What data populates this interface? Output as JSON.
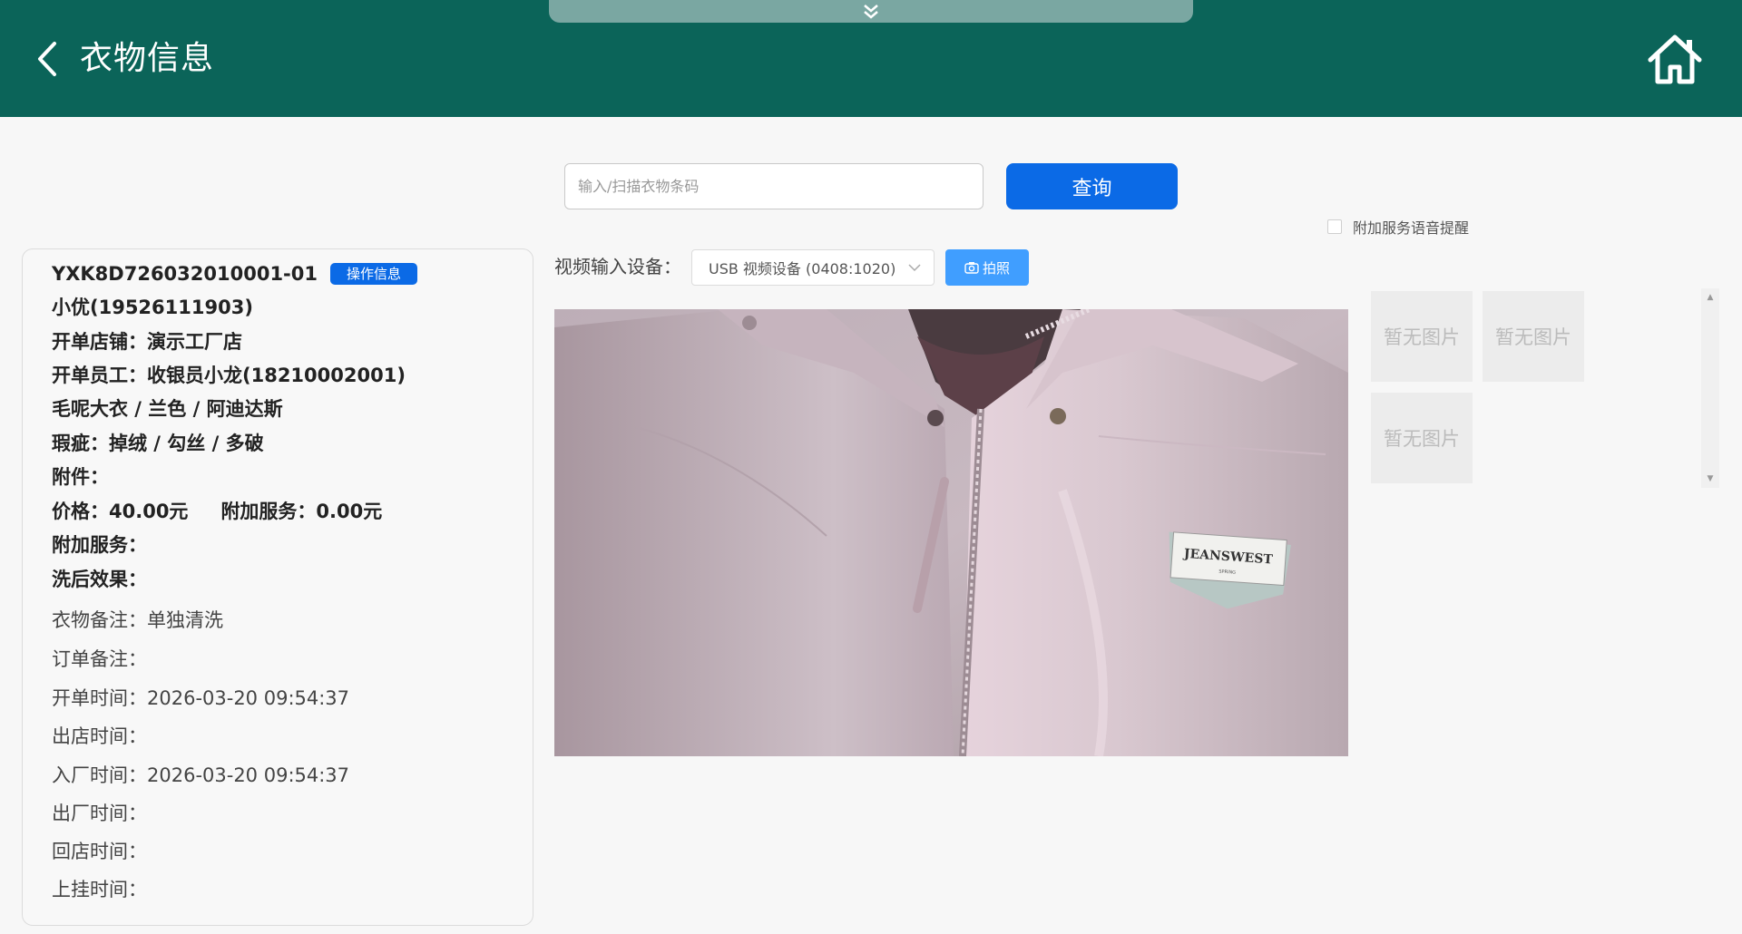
{
  "header": {
    "title": "衣物信息",
    "pull_tab_icon": "double-chevron-down-icon",
    "back_icon": "chevron-left-icon",
    "home_icon": "home-icon"
  },
  "search": {
    "placeholder": "输入/扫描衣物条码",
    "value": "",
    "query_label": "查询"
  },
  "voice_reminder": {
    "label": "附加服务语音提醒",
    "checked": false
  },
  "garment": {
    "code": "YXK8D726032010001-01",
    "op_badge": "操作信息",
    "customer": "小优(19526111903)",
    "store": "开单店铺：演示工厂店",
    "staff": "开单员工：收银员小龙(18210002001)",
    "desc": "毛呢大衣 / 兰色 / 阿迪达斯",
    "defects": "瑕疵：掉绒 / 勾丝 / 多破",
    "accessories": "附件：",
    "price": "价格：40.00元",
    "addon_price": "附加服务：0.00元",
    "addon_service": "附加服务：",
    "wash_effect": "洗后效果：",
    "garment_note": "衣物备注：单独清洗",
    "order_note": "订单备注：",
    "open_time": "开单时间：2026-03-20 09:54:37",
    "out_store_time": "出店时间：",
    "in_factory_time": "入厂时间：2026-03-20 09:54:37",
    "out_factory_time": "出厂时间：",
    "back_store_time": "回店时间：",
    "hang_time": "上挂时间："
  },
  "camera": {
    "device_label": "视频输入设备：",
    "device_selected": "USB 视频设备 (0408:1020)",
    "photo_label": "拍照",
    "photo_icon": "camera-icon",
    "brand_patch_text": "JEANSWEST",
    "brand_patch_sub": "SPRING"
  },
  "thumbnails": [
    {
      "label": "暂无图片"
    },
    {
      "label": "暂无图片"
    },
    {
      "label": "暂无图片"
    }
  ],
  "colors": {
    "header": "#0b6459",
    "primary": "#0b6ae6",
    "photo_button": "#409eff"
  }
}
